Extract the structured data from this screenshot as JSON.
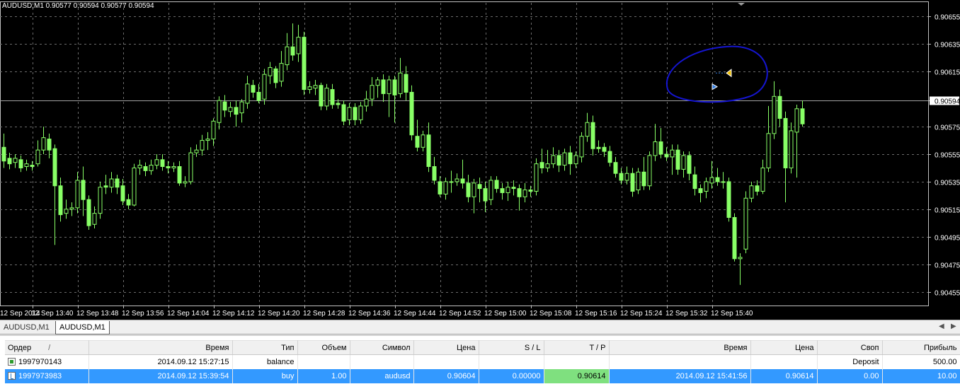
{
  "chart": {
    "title": "AUDUSD,M1  0.90577 0.90594 0.90577 0.90594",
    "current_price_label": "0.90594",
    "colors": {
      "background": "#000000",
      "grid": "#6b6b6b",
      "candle": "#88ff66",
      "axis_text": "#ffffff",
      "price_line": "#a0a0a0",
      "annotation": "#1515d0"
    }
  },
  "chart_data": {
    "type": "candlestick",
    "symbol": "AUDUSD",
    "timeframe": "M1",
    "ylim": [
      0.90445,
      0.90665
    ],
    "y_ticks": [
      "0.90655",
      "0.90635",
      "0.90615",
      "0.90594",
      "0.90575",
      "0.90555",
      "0.90535",
      "0.90515",
      "0.90495",
      "0.90475",
      "0.90455"
    ],
    "x_ticks": [
      "12 Sep 2014",
      "12 Sep 13:40",
      "12 Sep 13:48",
      "12 Sep 13:56",
      "12 Sep 14:04",
      "12 Sep 14:12",
      "12 Sep 14:20",
      "12 Sep 14:28",
      "12 Sep 14:36",
      "12 Sep 14:44",
      "12 Sep 14:52",
      "12 Sep 15:00",
      "12 Sep 15:08",
      "12 Sep 15:16",
      "12 Sep 15:24",
      "12 Sep 15:32",
      "12 Sep 15:40"
    ],
    "last_price": 0.90594,
    "candles": [
      [
        0.9056,
        0.9055,
        0.9057,
        0.90545
      ],
      [
        0.90552,
        0.90548,
        0.90556,
        0.90544
      ],
      [
        0.90549,
        0.90552,
        0.90555,
        0.90545
      ],
      [
        0.90551,
        0.90545,
        0.90554,
        0.90542
      ],
      [
        0.90546,
        0.90548,
        0.90551,
        0.90543
      ],
      [
        0.90547,
        0.90546,
        0.9055,
        0.90543
      ],
      [
        0.90548,
        0.90558,
        0.90565,
        0.90546
      ],
      [
        0.90558,
        0.90567,
        0.90575,
        0.90555
      ],
      [
        0.90566,
        0.90558,
        0.9057,
        0.90552
      ],
      [
        0.90559,
        0.90532,
        0.90562,
        0.90489
      ],
      [
        0.90532,
        0.90511,
        0.90538,
        0.90506
      ],
      [
        0.90512,
        0.90515,
        0.90522,
        0.90508
      ],
      [
        0.90515,
        0.90516,
        0.9052,
        0.9051
      ],
      [
        0.90516,
        0.90536,
        0.90542,
        0.90512
      ],
      [
        0.90536,
        0.90522,
        0.90546,
        0.9051
      ],
      [
        0.90522,
        0.90503,
        0.90525,
        0.905
      ],
      [
        0.90504,
        0.90512,
        0.90517,
        0.90501
      ],
      [
        0.90512,
        0.90531,
        0.90535,
        0.90508
      ],
      [
        0.90532,
        0.90531,
        0.9054,
        0.90526
      ],
      [
        0.90531,
        0.90537,
        0.90542,
        0.90527
      ],
      [
        0.90537,
        0.90531,
        0.9054,
        0.90526
      ],
      [
        0.90532,
        0.90521,
        0.90537,
        0.90518
      ],
      [
        0.90522,
        0.90518,
        0.90526,
        0.90515
      ],
      [
        0.90518,
        0.90545,
        0.90548,
        0.90517
      ],
      [
        0.90545,
        0.90547,
        0.90551,
        0.9054
      ],
      [
        0.90546,
        0.90543,
        0.90549,
        0.90539
      ],
      [
        0.90543,
        0.90547,
        0.90551,
        0.9054
      ],
      [
        0.90547,
        0.90551,
        0.90555,
        0.90544
      ],
      [
        0.90551,
        0.90546,
        0.90555,
        0.90543
      ],
      [
        0.90546,
        0.90545,
        0.9055,
        0.90541
      ],
      [
        0.90545,
        0.90546,
        0.90549,
        0.90542
      ],
      [
        0.90546,
        0.90534,
        0.9055,
        0.90532
      ],
      [
        0.90534,
        0.90535,
        0.90539,
        0.90531
      ],
      [
        0.90535,
        0.90556,
        0.9056,
        0.90533
      ],
      [
        0.90556,
        0.90558,
        0.90562,
        0.90553
      ],
      [
        0.90558,
        0.90565,
        0.90569,
        0.90554
      ],
      [
        0.90565,
        0.90566,
        0.90571,
        0.90558
      ],
      [
        0.90566,
        0.90579,
        0.90581,
        0.90561
      ],
      [
        0.90578,
        0.90594,
        0.90597,
        0.90573
      ],
      [
        0.90593,
        0.90587,
        0.90598,
        0.90582
      ],
      [
        0.90586,
        0.90589,
        0.90593,
        0.90582
      ],
      [
        0.90589,
        0.90584,
        0.90594,
        0.90575
      ],
      [
        0.90585,
        0.90593,
        0.90595,
        0.90578
      ],
      [
        0.90592,
        0.90606,
        0.90612,
        0.90588
      ],
      [
        0.90605,
        0.906,
        0.90609,
        0.90596
      ],
      [
        0.906,
        0.90594,
        0.90606,
        0.90592
      ],
      [
        0.90595,
        0.90613,
        0.90617,
        0.90591
      ],
      [
        0.90612,
        0.90618,
        0.90622,
        0.90606
      ],
      [
        0.90617,
        0.90607,
        0.90619,
        0.90603
      ],
      [
        0.90608,
        0.90621,
        0.9063,
        0.90604
      ],
      [
        0.9062,
        0.90633,
        0.90643,
        0.90616
      ],
      [
        0.90633,
        0.90627,
        0.9065,
        0.90623
      ],
      [
        0.90628,
        0.9064,
        0.90649,
        0.90622
      ],
      [
        0.9064,
        0.90602,
        0.90644,
        0.90598
      ],
      [
        0.90602,
        0.90604,
        0.90608,
        0.90599
      ],
      [
        0.90603,
        0.90605,
        0.90609,
        0.90598
      ],
      [
        0.90605,
        0.9059,
        0.90607,
        0.90587
      ],
      [
        0.9059,
        0.90603,
        0.90606,
        0.90587
      ],
      [
        0.90602,
        0.90591,
        0.90606,
        0.90588
      ],
      [
        0.90592,
        0.90591,
        0.90595,
        0.90588
      ],
      [
        0.90591,
        0.90579,
        0.90594,
        0.90576
      ],
      [
        0.9058,
        0.90589,
        0.90592,
        0.90576
      ],
      [
        0.90589,
        0.9058,
        0.90592,
        0.90576
      ],
      [
        0.9058,
        0.9059,
        0.90593,
        0.90577
      ],
      [
        0.9059,
        0.90595,
        0.90601,
        0.90586
      ],
      [
        0.90595,
        0.90605,
        0.90611,
        0.9059
      ],
      [
        0.90605,
        0.90609,
        0.90611,
        0.90596
      ],
      [
        0.90609,
        0.90599,
        0.90613,
        0.90593
      ],
      [
        0.90599,
        0.90609,
        0.90612,
        0.90582
      ],
      [
        0.90609,
        0.90598,
        0.90612,
        0.90578
      ],
      [
        0.90599,
        0.90614,
        0.90625,
        0.90596
      ],
      [
        0.90613,
        0.906,
        0.90619,
        0.90594
      ],
      [
        0.906,
        0.90569,
        0.90605,
        0.90565
      ],
      [
        0.90568,
        0.9056,
        0.9058,
        0.90557
      ],
      [
        0.9056,
        0.90569,
        0.90572,
        0.90557
      ],
      [
        0.90569,
        0.90546,
        0.90578,
        0.90542
      ],
      [
        0.90546,
        0.90536,
        0.90553,
        0.90533
      ],
      [
        0.90535,
        0.90526,
        0.90539,
        0.90524
      ],
      [
        0.90526,
        0.90535,
        0.90538,
        0.90522
      ],
      [
        0.90535,
        0.90535,
        0.90543,
        0.90527
      ],
      [
        0.90535,
        0.90537,
        0.90541,
        0.90532
      ],
      [
        0.90537,
        0.90534,
        0.90551,
        0.9053
      ],
      [
        0.90534,
        0.90524,
        0.9054,
        0.9052
      ],
      [
        0.90524,
        0.90534,
        0.90537,
        0.90512
      ],
      [
        0.90533,
        0.9053,
        0.90538,
        0.9052
      ],
      [
        0.9053,
        0.90521,
        0.90535,
        0.90513
      ],
      [
        0.90522,
        0.90536,
        0.90539,
        0.90518
      ],
      [
        0.90536,
        0.9053,
        0.90539,
        0.90527
      ],
      [
        0.9053,
        0.90527,
        0.90534,
        0.90522
      ],
      [
        0.90527,
        0.90531,
        0.90535,
        0.90521
      ],
      [
        0.90531,
        0.9053,
        0.90536,
        0.90525
      ],
      [
        0.9053,
        0.90524,
        0.90533,
        0.90514
      ],
      [
        0.90524,
        0.90529,
        0.90534,
        0.9052
      ],
      [
        0.90529,
        0.90528,
        0.90532,
        0.90524
      ],
      [
        0.90528,
        0.90548,
        0.90552,
        0.90525
      ],
      [
        0.90549,
        0.90545,
        0.90559,
        0.90541
      ],
      [
        0.90545,
        0.90548,
        0.90558,
        0.90542
      ],
      [
        0.90548,
        0.90554,
        0.9056,
        0.90545
      ],
      [
        0.90554,
        0.90547,
        0.90558,
        0.90542
      ],
      [
        0.90547,
        0.90556,
        0.90559,
        0.90543
      ],
      [
        0.90556,
        0.90548,
        0.90561,
        0.9054
      ],
      [
        0.90548,
        0.90554,
        0.90557,
        0.90545
      ],
      [
        0.90553,
        0.90568,
        0.90571,
        0.90549
      ],
      [
        0.90568,
        0.90578,
        0.90585,
        0.90564
      ],
      [
        0.90578,
        0.90559,
        0.90583,
        0.90554
      ],
      [
        0.9056,
        0.90559,
        0.90565,
        0.90556
      ],
      [
        0.9056,
        0.90557,
        0.90563,
        0.90553
      ],
      [
        0.90557,
        0.90549,
        0.90561,
        0.90546
      ],
      [
        0.90549,
        0.90541,
        0.90553,
        0.90538
      ],
      [
        0.90541,
        0.90536,
        0.90545,
        0.90533
      ],
      [
        0.90536,
        0.90541,
        0.90546,
        0.90533
      ],
      [
        0.90541,
        0.90528,
        0.90545,
        0.90524
      ],
      [
        0.90529,
        0.90542,
        0.90545,
        0.90526
      ],
      [
        0.90542,
        0.90532,
        0.90553,
        0.90529
      ],
      [
        0.90532,
        0.90554,
        0.90557,
        0.90529
      ],
      [
        0.90554,
        0.90564,
        0.90577,
        0.9055
      ],
      [
        0.90564,
        0.90555,
        0.90574,
        0.90552
      ],
      [
        0.90555,
        0.90553,
        0.9056,
        0.9055
      ],
      [
        0.90553,
        0.90558,
        0.90562,
        0.9054
      ],
      [
        0.90558,
        0.90544,
        0.90562,
        0.9054
      ],
      [
        0.90544,
        0.90554,
        0.90557,
        0.90538
      ],
      [
        0.90554,
        0.90541,
        0.90557,
        0.90536
      ],
      [
        0.9054,
        0.9053,
        0.90546,
        0.90525
      ],
      [
        0.9053,
        0.90527,
        0.90533,
        0.9052
      ],
      [
        0.90528,
        0.90535,
        0.90538,
        0.90523
      ],
      [
        0.90534,
        0.90538,
        0.9055,
        0.9053
      ],
      [
        0.90538,
        0.90535,
        0.90545,
        0.90532
      ],
      [
        0.90535,
        0.90535,
        0.90542,
        0.9053
      ],
      [
        0.90535,
        0.90509,
        0.90538,
        0.90506
      ],
      [
        0.90509,
        0.90479,
        0.90512,
        0.90477
      ],
      [
        0.90479,
        0.9048,
        0.90483,
        0.9046
      ],
      [
        0.90486,
        0.90523,
        0.90528,
        0.90483
      ],
      [
        0.90523,
        0.90532,
        0.90535,
        0.9052
      ],
      [
        0.90532,
        0.90528,
        0.90536,
        0.90525
      ],
      [
        0.90528,
        0.90545,
        0.90551,
        0.90526
      ],
      [
        0.90545,
        0.9057,
        0.9059,
        0.90542
      ],
      [
        0.9057,
        0.90597,
        0.90608,
        0.90566
      ],
      [
        0.90597,
        0.90581,
        0.90602,
        0.90575
      ],
      [
        0.90581,
        0.90545,
        0.90586,
        0.9052
      ],
      [
        0.90545,
        0.90572,
        0.90578,
        0.90541
      ],
      [
        0.90571,
        0.90588,
        0.90591,
        0.90538
      ],
      [
        0.90588,
        0.90577,
        0.90594,
        0.90575
      ]
    ],
    "annotations": {
      "buy_marker_price": 0.90604,
      "tp_marker_price": 0.90614,
      "circle_label": ""
    }
  },
  "tabs": [
    {
      "label": "AUDUSD,M1",
      "active": false
    },
    {
      "label": "AUDUSD,M1",
      "active": true
    }
  ],
  "orders": {
    "columns": [
      "Ордер",
      "Время",
      "Тип",
      "Объем",
      "Символ",
      "Цена",
      "S / L",
      "T / P",
      "Время",
      "Цена",
      "Своп",
      "Прибыль"
    ],
    "sort_mark": "/",
    "rows": [
      {
        "order": "1997970143",
        "time": "2014.09.12 15:27:15",
        "type": "balance",
        "volume": "",
        "symbol": "",
        "price": "",
        "sl": "",
        "tp": "",
        "close_time": "",
        "close_price": "",
        "swap": "Deposit",
        "profit": "500.00",
        "selected": false,
        "icon": "balance-icon"
      },
      {
        "order": "1997973983",
        "time": "2014.09.12 15:39:54",
        "type": "buy",
        "volume": "1.00",
        "symbol": "audusd",
        "price": "0.90604",
        "sl": "0.00000",
        "tp": "0.90614",
        "close_time": "2014.09.12 15:41:56",
        "close_price": "0.90614",
        "swap": "0.00",
        "profit": "10.00",
        "selected": true,
        "icon": "order-icon"
      }
    ]
  }
}
